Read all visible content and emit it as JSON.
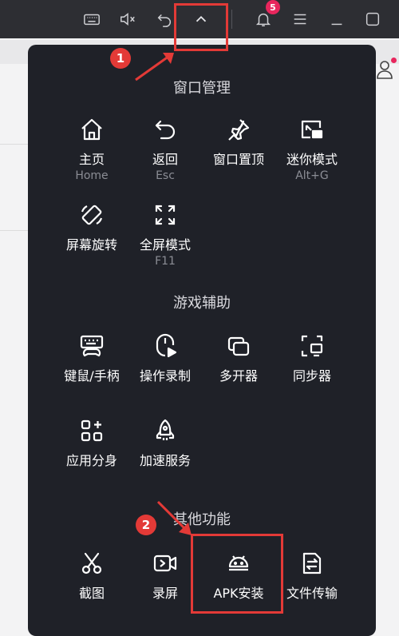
{
  "topbar": {
    "notification_count": "5"
  },
  "menu": {
    "sections": [
      {
        "title": "窗口管理",
        "items": [
          {
            "label": "主页",
            "shortcut": "Home"
          },
          {
            "label": "返回",
            "shortcut": "Esc"
          },
          {
            "label": "窗口置顶",
            "shortcut": ""
          },
          {
            "label": "迷你模式",
            "shortcut": "Alt+G"
          },
          {
            "label": "屏幕旋转",
            "shortcut": ""
          },
          {
            "label": "全屏模式",
            "shortcut": "F11"
          }
        ]
      },
      {
        "title": "游戏辅助",
        "items": [
          {
            "label": "键鼠/手柄"
          },
          {
            "label": "操作录制"
          },
          {
            "label": "多开器"
          },
          {
            "label": "同步器"
          },
          {
            "label": "应用分身"
          },
          {
            "label": "加速服务"
          }
        ]
      },
      {
        "title": "其他功能",
        "items": [
          {
            "label": "截图"
          },
          {
            "label": "录屏"
          },
          {
            "label": "APK安装"
          },
          {
            "label": "文件传输"
          }
        ]
      }
    ]
  },
  "annotations": {
    "step1": "1",
    "step2": "2",
    "color": "#e33a37"
  },
  "icons": [
    "keyboard-icon",
    "mute-icon",
    "back-icon",
    "chevron-up-icon",
    "bell-icon",
    "menu-icon",
    "minimize-icon",
    "maximize-icon"
  ]
}
